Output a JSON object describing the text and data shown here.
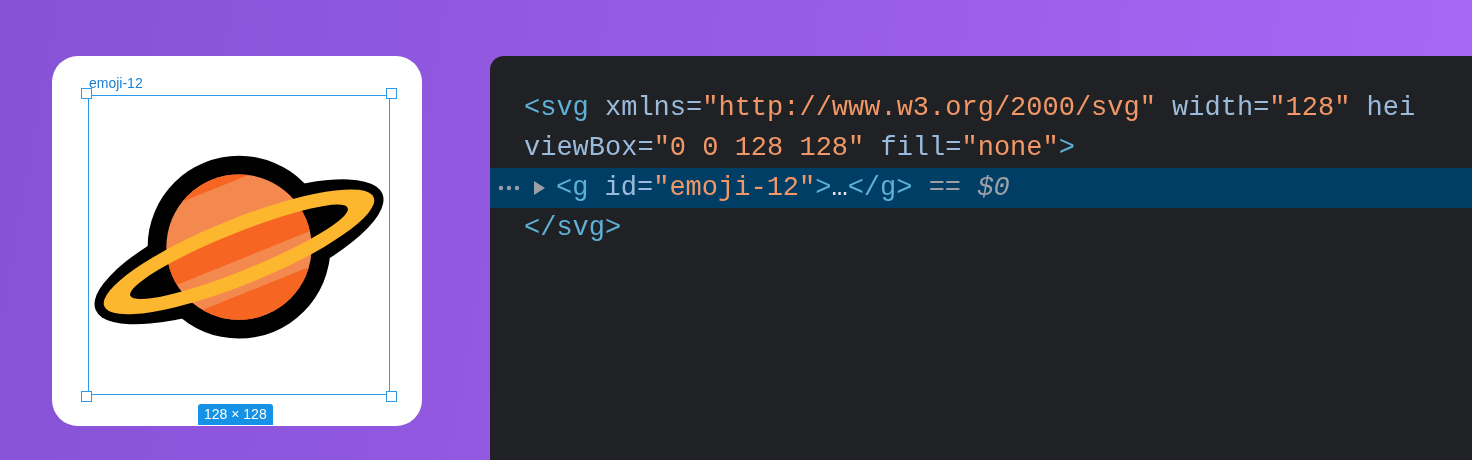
{
  "canvas": {
    "frame_label": "emoji-12",
    "size_badge": "128 × 128"
  },
  "code": {
    "lines": [
      {
        "selected": false,
        "expandable": false,
        "tokens": [
          {
            "kind": "tag",
            "text": "<svg"
          },
          {
            "kind": "attr",
            "text": " xmlns="
          },
          {
            "kind": "value",
            "text": "\"http://www.w3.org/2000/svg\""
          },
          {
            "kind": "attr",
            "text": " width="
          },
          {
            "kind": "value",
            "text": "\"128\""
          },
          {
            "kind": "attr",
            "text": " hei"
          }
        ]
      },
      {
        "selected": false,
        "expandable": false,
        "tokens": [
          {
            "kind": "attr",
            "text": "viewBox="
          },
          {
            "kind": "value",
            "text": "\"0 0 128 128\""
          },
          {
            "kind": "attr",
            "text": " fill="
          },
          {
            "kind": "value",
            "text": "\"none\""
          },
          {
            "kind": "tag",
            "text": ">"
          }
        ]
      },
      {
        "selected": true,
        "expandable": true,
        "tokens": [
          {
            "kind": "tag",
            "text": "<g"
          },
          {
            "kind": "attr",
            "text": " id="
          },
          {
            "kind": "value",
            "text": "\"emoji-12\""
          },
          {
            "kind": "tag",
            "text": ">"
          },
          {
            "kind": "punct",
            "text": "…"
          },
          {
            "kind": "tag",
            "text": "</g>"
          },
          {
            "kind": "eq",
            "text": " == "
          },
          {
            "kind": "var",
            "text": "$0"
          }
        ]
      },
      {
        "selected": false,
        "expandable": false,
        "tokens": [
          {
            "kind": "tag",
            "text": "</svg>"
          }
        ]
      }
    ]
  }
}
